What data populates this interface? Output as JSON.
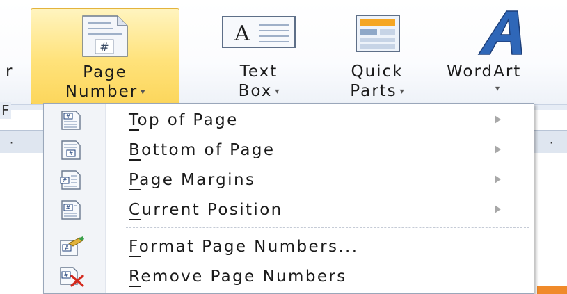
{
  "ribbon": {
    "left_cut_label": "r",
    "page_number": {
      "line1": "Page",
      "line2": "Number"
    },
    "text_box": {
      "line1": "Text",
      "line2": "Box"
    },
    "quick_parts": {
      "line1": "Quick",
      "line2": "Parts"
    },
    "wordart": {
      "line1": "WordArt"
    },
    "dropdown_arrow": "▾",
    "group_label_cut": "F",
    "highlight_color": "#ffe27a"
  },
  "menu": {
    "items": [
      {
        "label": "Top of Page",
        "icon": "page-number-top-icon",
        "has_submenu": true
      },
      {
        "label": "Bottom of Page",
        "icon": "page-number-bottom-icon",
        "has_submenu": true
      },
      {
        "label": "Page Margins",
        "icon": "page-margins-icon",
        "has_submenu": true
      },
      {
        "label": "Current Position",
        "icon": "current-position-icon",
        "has_submenu": true
      },
      {
        "label": "Format Page Numbers...",
        "icon": "format-page-numbers-icon",
        "has_submenu": false
      },
      {
        "label": "Remove Page Numbers",
        "icon": "remove-page-numbers-icon",
        "has_submenu": false
      }
    ]
  }
}
